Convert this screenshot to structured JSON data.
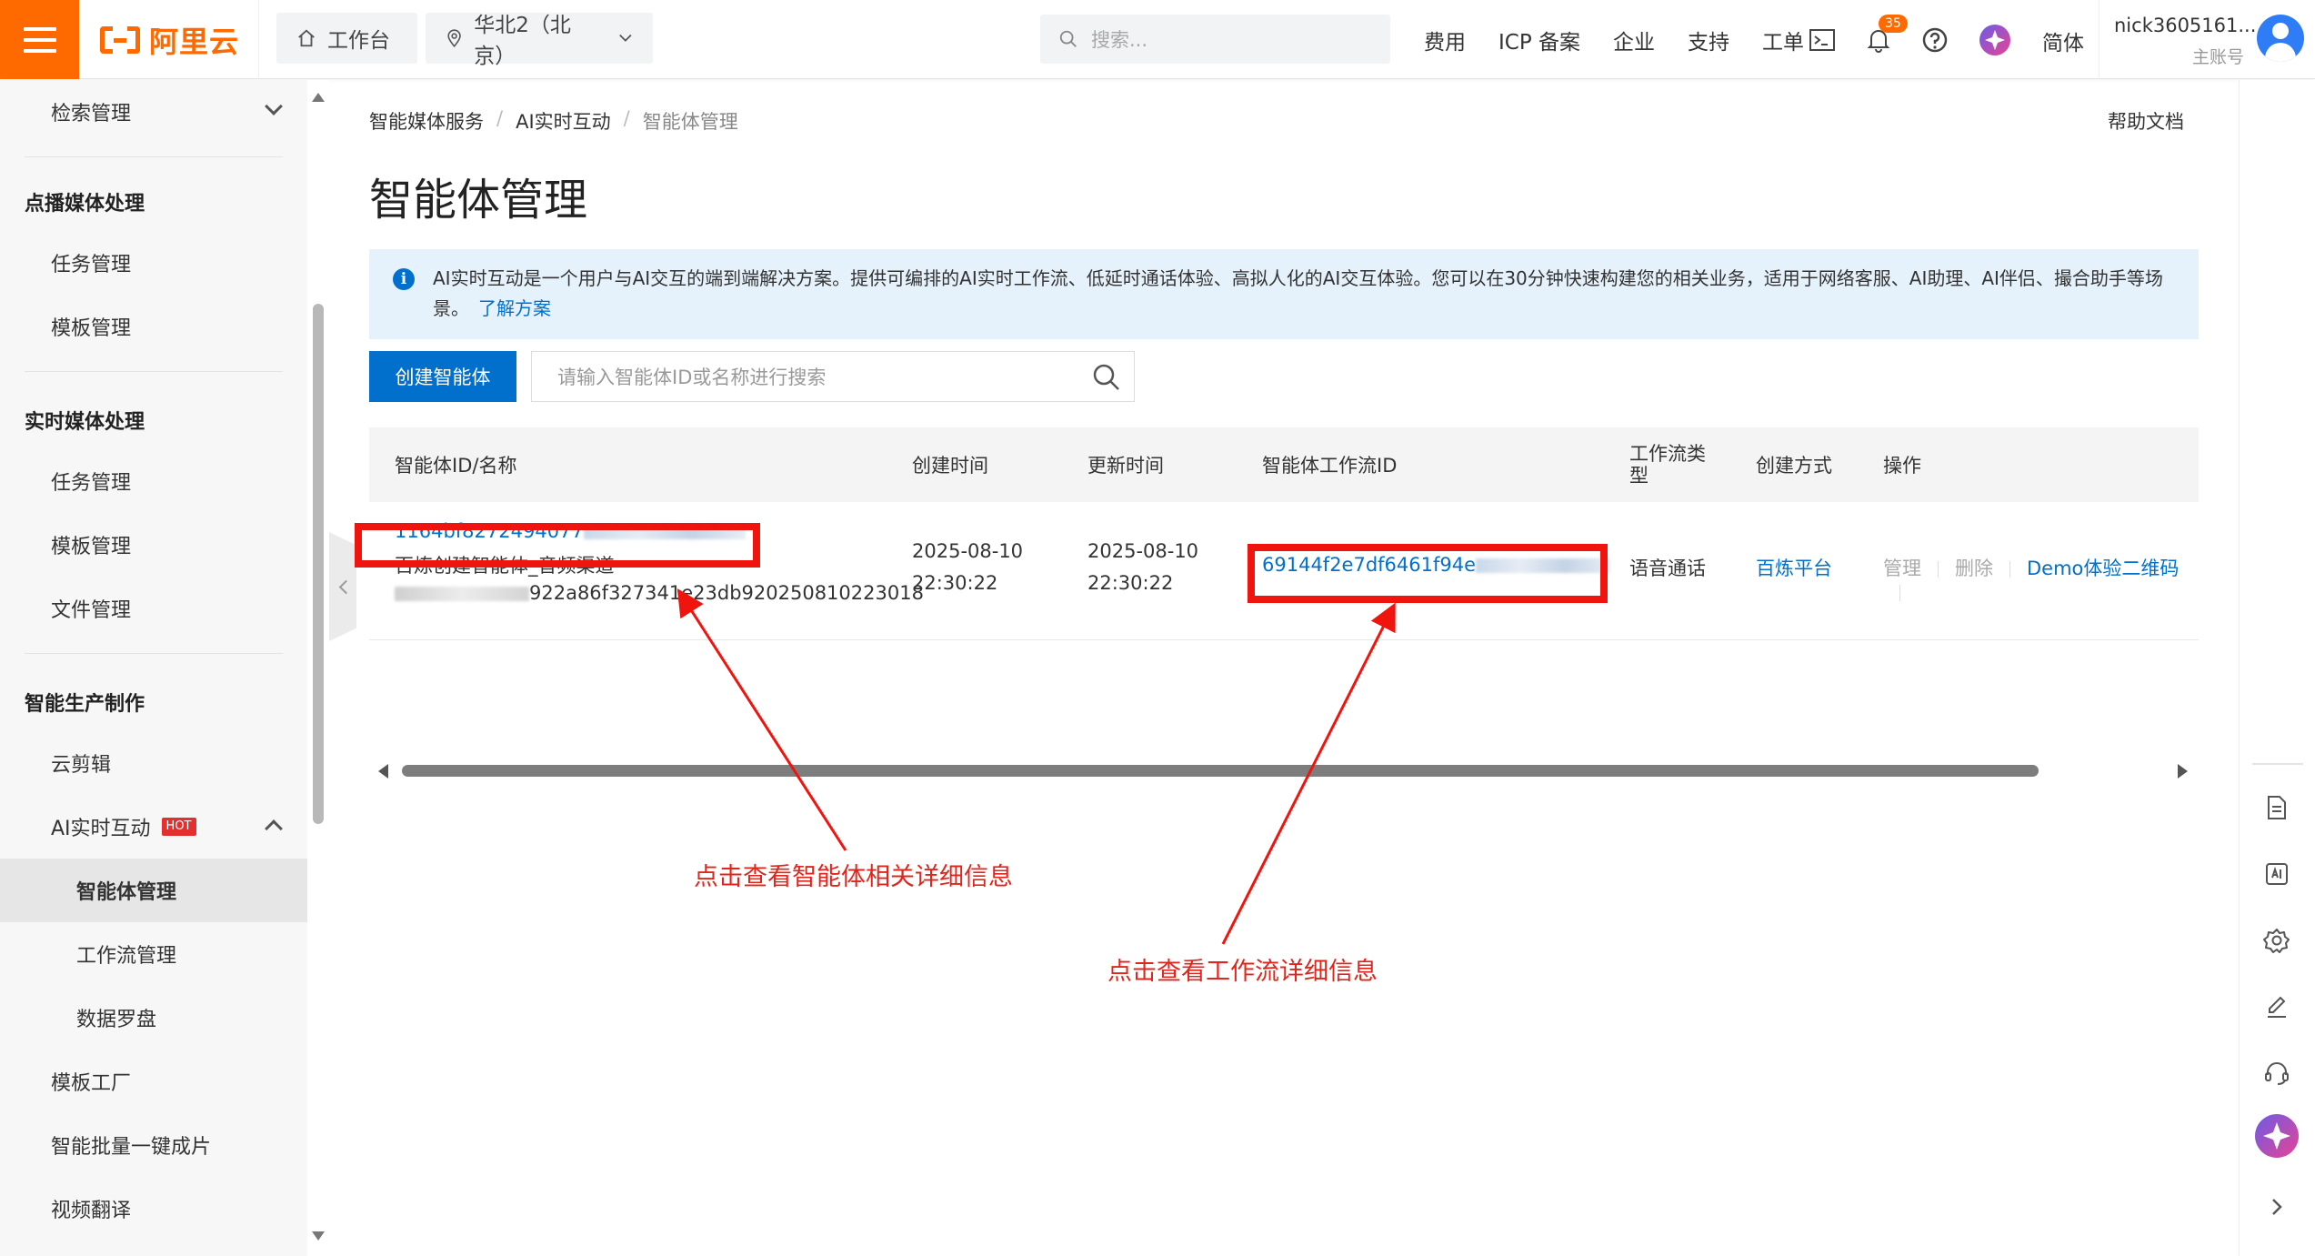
{
  "topbar": {
    "workbench": "工作台",
    "region": "华北2（北京）",
    "search_placeholder": "搜索...",
    "links": [
      "费用",
      "ICP 备案",
      "企业",
      "支持",
      "工单"
    ],
    "notification_count": "35",
    "language": "简体",
    "username": "nick3605161...",
    "account_type": "主账号",
    "brand_color": "#ff6a00"
  },
  "logo": {
    "text": "阿里云"
  },
  "sidebar": {
    "search_mgmt": "检索管理",
    "group_vod": "点播媒体处理",
    "vod_task": "任务管理",
    "vod_template": "模板管理",
    "group_live": "实时媒体处理",
    "live_task": "任务管理",
    "live_template": "模板管理",
    "live_file": "文件管理",
    "group_prod": "智能生产制作",
    "cloud_edit": "云剪辑",
    "ai_rtc": "AI实时互动",
    "hot": "HOT",
    "agent_mgmt": "智能体管理",
    "workflow_mgmt": "工作流管理",
    "data_dashboard": "数据罗盘",
    "template_factory": "模板工厂",
    "batch_gen": "智能批量一键成片",
    "video_translate": "视频翻译"
  },
  "main": {
    "breadcrumb": [
      "智能媒体服务",
      "AI实时互动",
      "智能体管理"
    ],
    "help": "帮助文档",
    "title": "智能体管理",
    "notice_text": "AI实时互动是一个用户与AI交互的端到端解决方案。提供可编排的AI实时工作流、低延时通话体验、高拟人化的AI交互体验。您可以在30分钟快速构建您的相关业务，适用于网络客服、AI助理、AI伴侣、撮合助手等场景。",
    "notice_link": "了解方案",
    "create_button": "创建智能体",
    "search_placeholder": "请输入智能体ID或名称进行搜索",
    "columns": {
      "id_name": "智能体ID/名称",
      "created": "创建时间",
      "updated": "更新时间",
      "workflow_id": "智能体工作流ID",
      "workflow_type": "工作流类型",
      "create_mode": "创建方式",
      "actions": "操作"
    },
    "rows": [
      {
        "agent_id": "1164bf8272494077",
        "agent_name": "百炼创建智能体_音频渠道",
        "agent_extra": "922a86f327341e23db920250810223018",
        "created_date": "2025-08-10",
        "created_time": "22:30:22",
        "updated_date": "2025-08-10",
        "updated_time": "22:30:22",
        "workflow_id": "69144f2e7df6461f94e",
        "workflow_type": "语音通话",
        "create_mode": "百炼平台",
        "action_manage": "管理",
        "action_delete": "删除",
        "action_demo": "Demo体验二维码"
      }
    ]
  },
  "annotations": {
    "agent_hint": "点击查看智能体相关详细信息",
    "workflow_hint": "点击查看工作流详细信息",
    "color": "#e0261c"
  }
}
